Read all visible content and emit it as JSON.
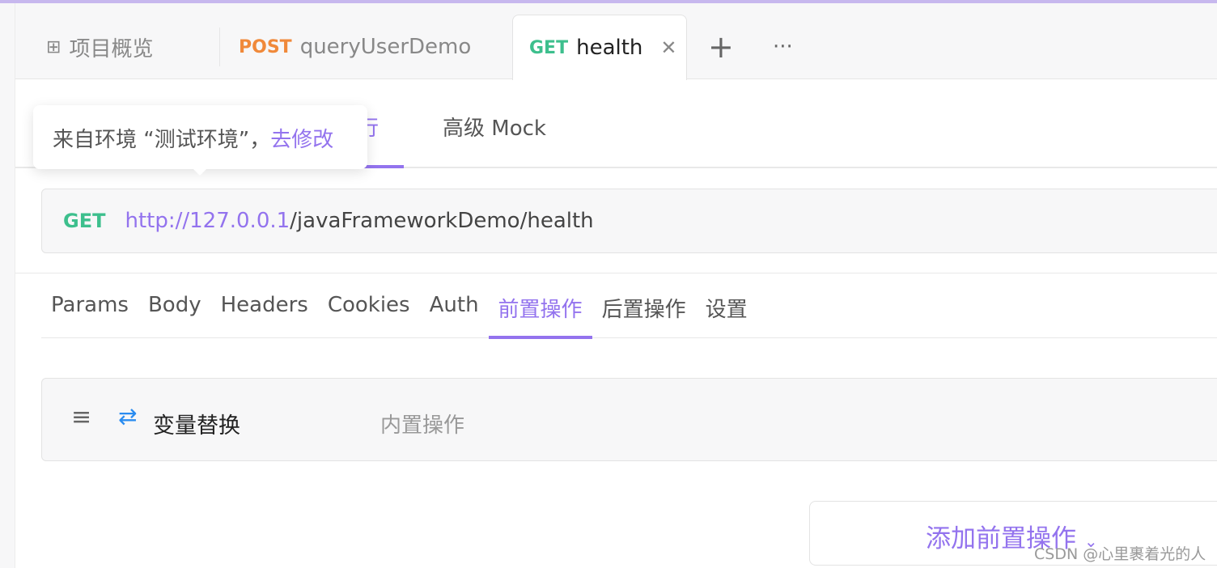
{
  "tabs": [
    {
      "icon": "grid-icon",
      "label": "项目概览"
    },
    {
      "method": "POST",
      "label": "queryUserDemo"
    },
    {
      "method": "GET",
      "label": "health",
      "active": true
    }
  ],
  "tab_actions": {
    "close": "✕",
    "add": "+",
    "more": "···"
  },
  "subtabs": {
    "hidden": "运行",
    "mock": "高级 Mock"
  },
  "tooltip": {
    "text": "来自环境 “测试环境”，",
    "link": "去修改"
  },
  "url": {
    "method": "GET",
    "base": "http://127.0.0.1",
    "path": "/javaFrameworkDemo/health"
  },
  "request_tabs": [
    "Params",
    "Body",
    "Headers",
    "Cookies",
    "Auth",
    "前置操作",
    "后置操作",
    "设置"
  ],
  "active_request_tab": "前置操作",
  "operation": {
    "name": "变量替换",
    "type": "内置操作"
  },
  "add_button": "添加前置操作",
  "watermark": "CSDN @心里裹着光的人",
  "colors": {
    "accent": "#9373ee",
    "get": "#3dbf8d",
    "post": "#f0893a"
  }
}
